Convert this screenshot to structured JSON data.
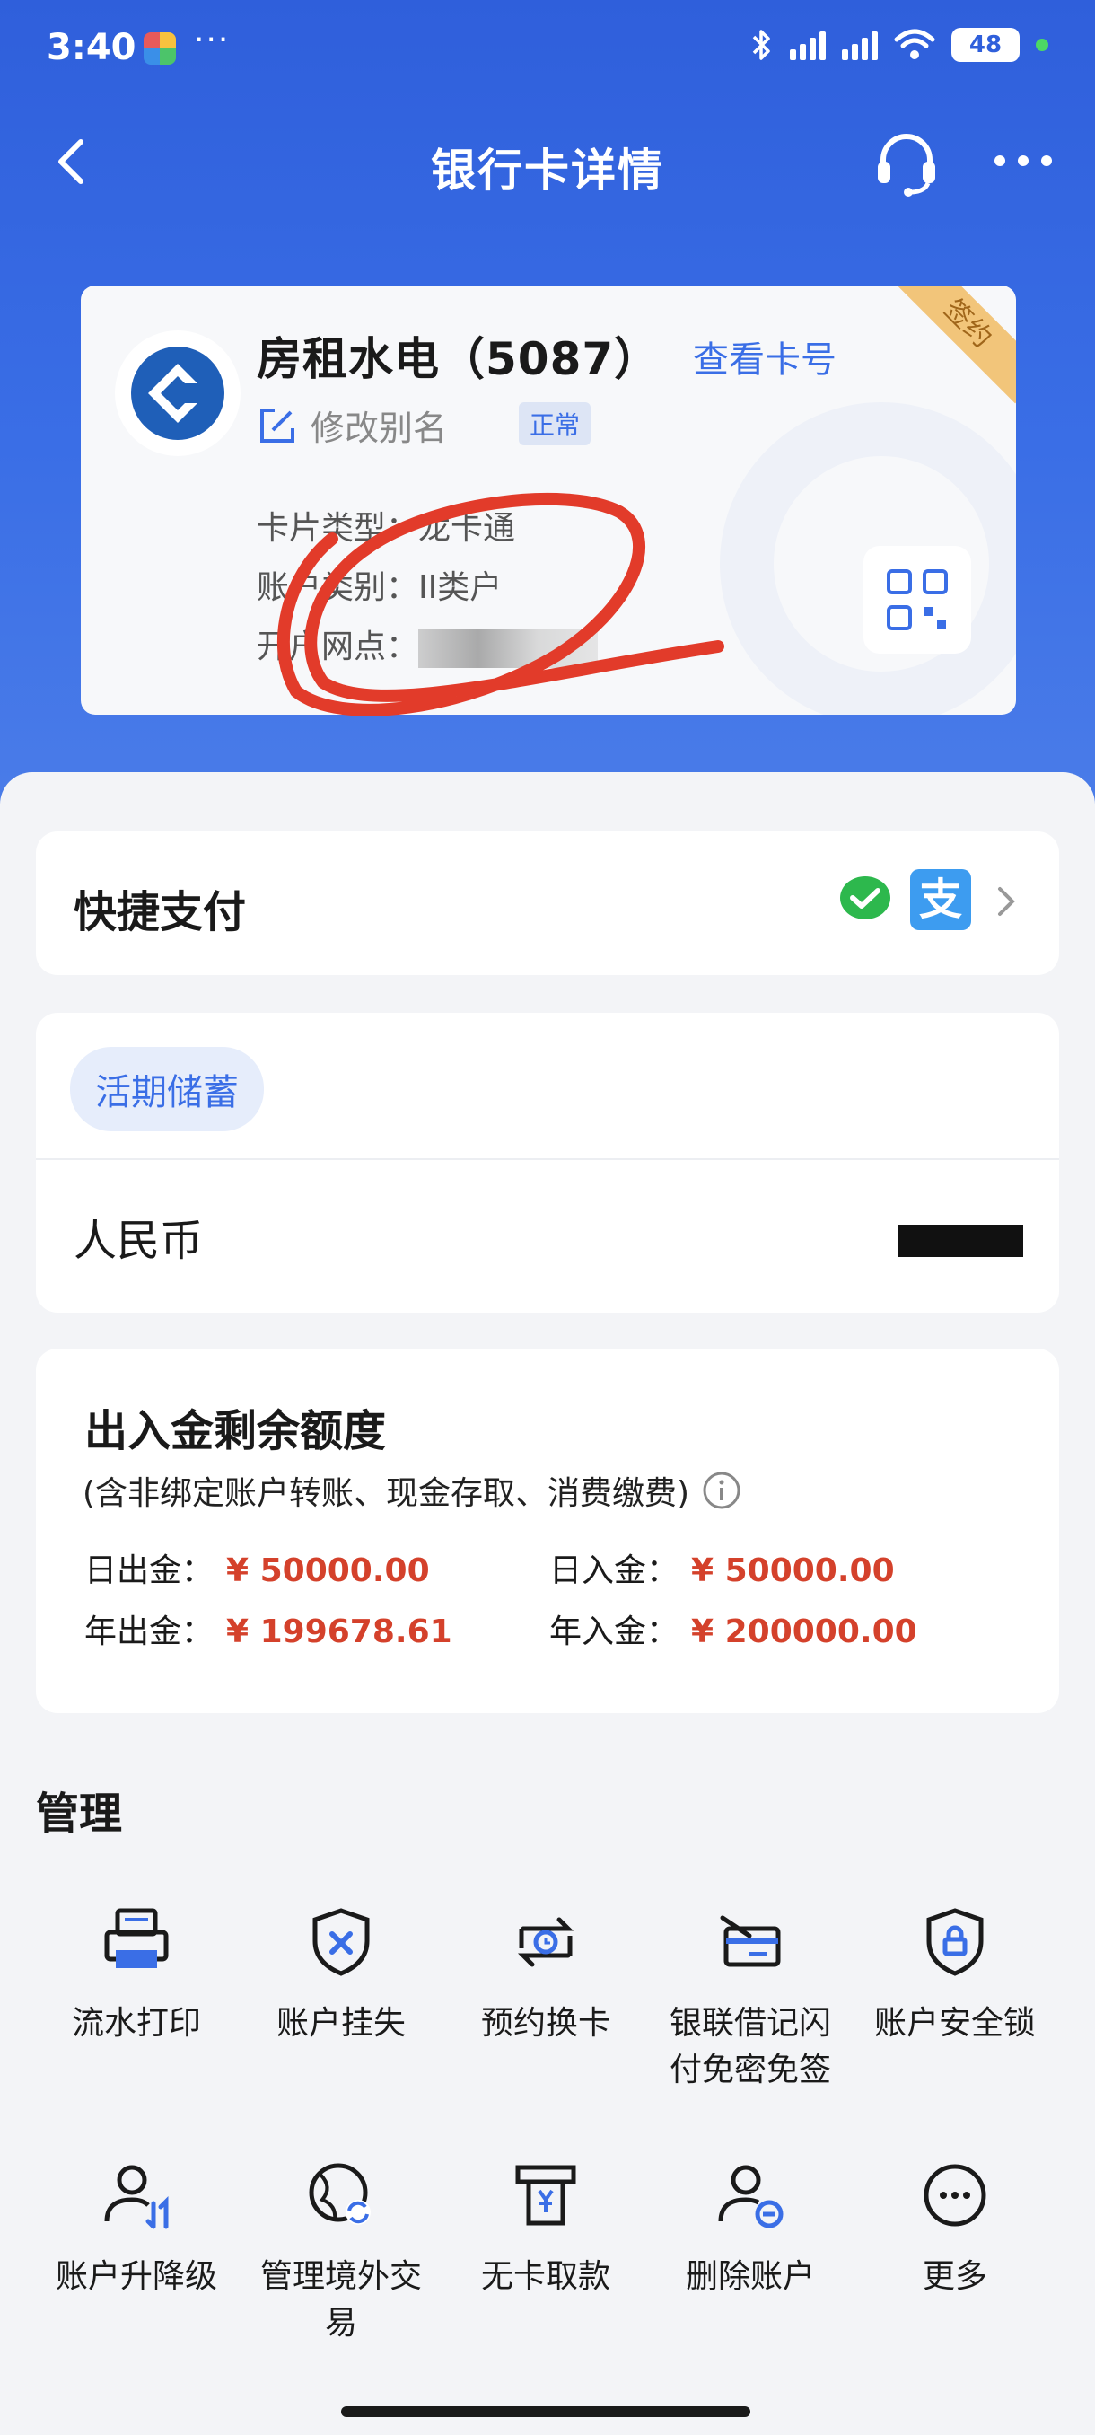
{
  "status_bar": {
    "time": "3:40",
    "dots": "···",
    "battery": "48"
  },
  "nav": {
    "title": "银行卡详情"
  },
  "card": {
    "name": "房租水电（5087）",
    "view_card_no": "查看卡号",
    "sign_ribbon": "签约",
    "edit_alias": "修改别名",
    "status": "正常",
    "card_type_label": "卡片类型：",
    "card_type_value": "龙卡通",
    "account_class_label": "账户类别：",
    "account_class_value": "II类户",
    "branch_label": "开户网点："
  },
  "quick_pay": {
    "label": "快捷支付",
    "alipay_glyph": "支"
  },
  "savings": {
    "chip": "活期储蓄",
    "currency": "人民币"
  },
  "limits": {
    "title": "出入金剩余额度",
    "subtitle": "(含非绑定账户转账、现金存取、消费缴费)",
    "daily_out_label": "日出金：",
    "daily_out_value": "¥ 50000.00",
    "daily_in_label": "日入金：",
    "daily_in_value": "¥ 50000.00",
    "yearly_out_label": "年出金：",
    "yearly_out_value": "¥ 199678.61",
    "yearly_in_label": "年入金：",
    "yearly_in_value": "¥ 200000.00"
  },
  "manage": {
    "title": "管理",
    "items": [
      {
        "label": "流水打印",
        "icon": "printer-icon"
      },
      {
        "label": "账户挂失",
        "icon": "shield-x-icon"
      },
      {
        "label": "预约换卡",
        "icon": "card-swap-icon"
      },
      {
        "label": "银联借记闪付免密免签",
        "icon": "card-tap-icon"
      },
      {
        "label": "账户安全锁",
        "icon": "shield-lock-icon"
      },
      {
        "label": "账户升降级",
        "icon": "user-updown-icon"
      },
      {
        "label": "管理境外交易",
        "icon": "globe-refresh-icon"
      },
      {
        "label": "无卡取款",
        "icon": "atm-withdraw-icon"
      },
      {
        "label": "删除账户",
        "icon": "user-remove-icon"
      },
      {
        "label": "更多",
        "icon": "more-circle-icon"
      }
    ]
  },
  "colors": {
    "brand": "#3a6ee6",
    "amount": "#d4412b",
    "header": "#2f5fdb"
  }
}
